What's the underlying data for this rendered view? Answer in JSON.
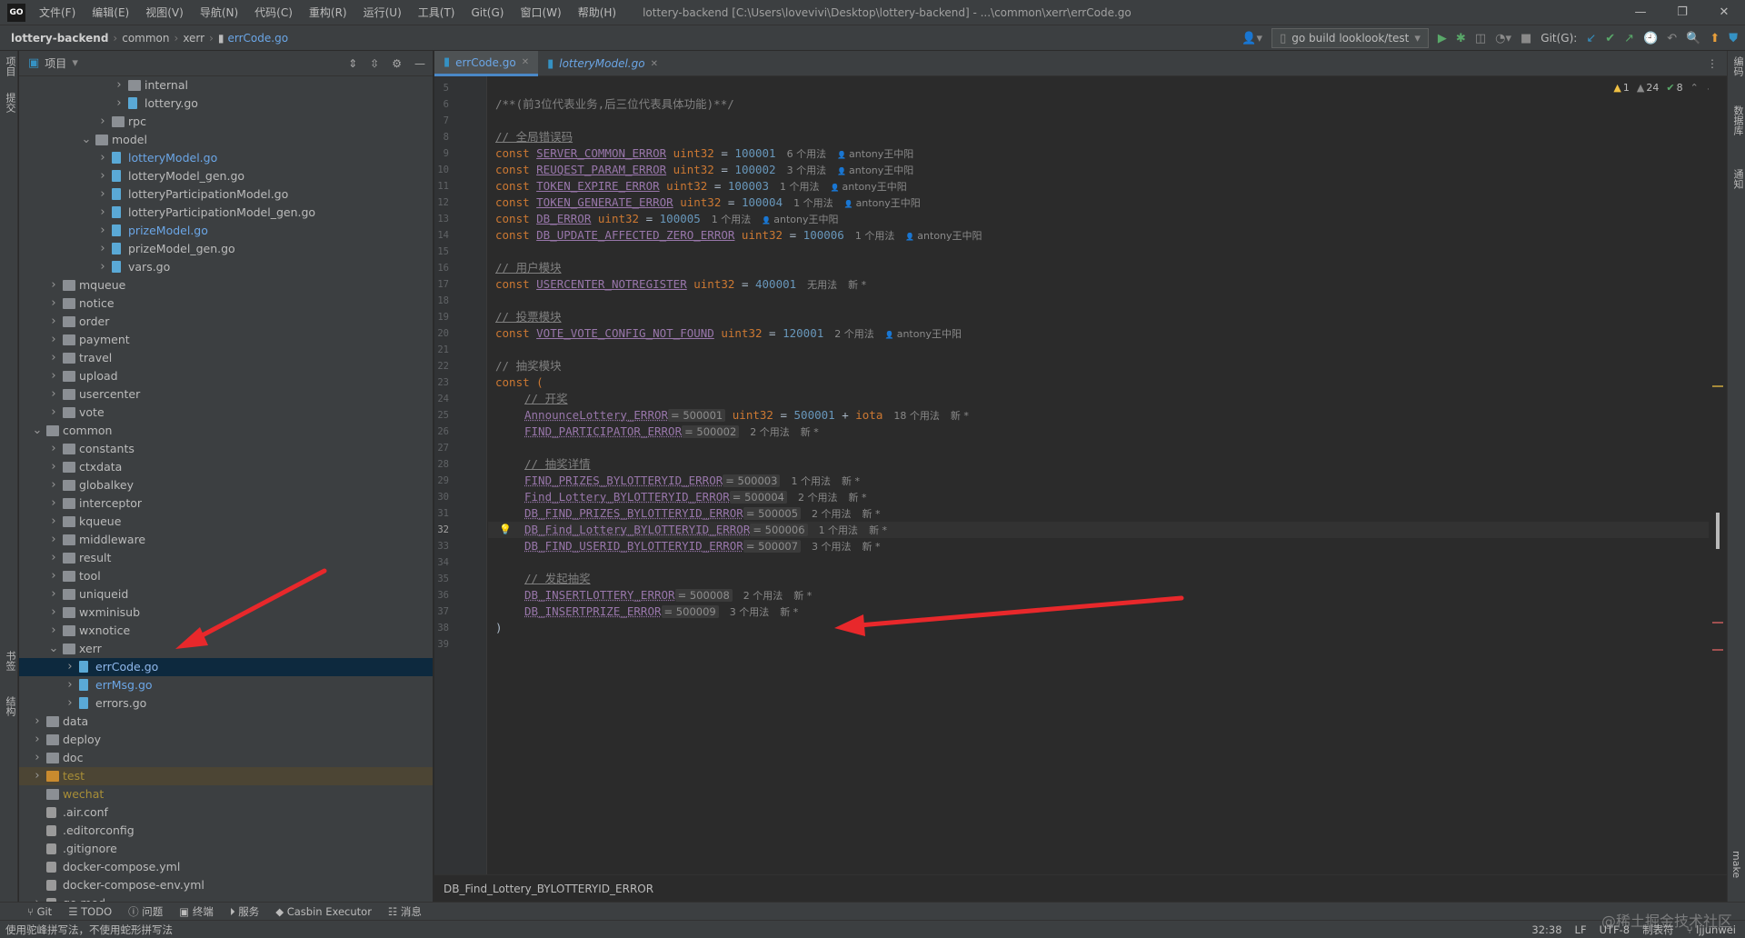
{
  "app": {
    "logo": "GO",
    "menu": [
      "文件(F)",
      "编辑(E)",
      "视图(V)",
      "导航(N)",
      "代码(C)",
      "重构(R)",
      "运行(U)",
      "工具(T)",
      "Git(G)",
      "窗口(W)",
      "帮助(H)"
    ],
    "window_title": "lottery-backend [C:\\Users\\lovevivi\\Desktop\\lottery-backend] - ...\\common\\xerr\\errCode.go",
    "win_controls": [
      "—",
      "❐",
      "✕"
    ]
  },
  "breadcrumb": [
    "lottery-backend",
    "common",
    "xerr",
    "errCode.go"
  ],
  "toolbar": {
    "run_config": "go build looklook/test",
    "git_label": "Git(G):"
  },
  "left_stripe": [
    "项目",
    "提交",
    "书签",
    "结构"
  ],
  "right_stripe": [
    "编码",
    "数据库",
    "通知",
    "make"
  ],
  "project_panel": {
    "title": "项目",
    "tree": [
      {
        "label": "internal",
        "type": "folder",
        "depth": 6,
        "arrow": "›"
      },
      {
        "label": "lottery.go",
        "type": "go",
        "depth": 6,
        "arrow": "›"
      },
      {
        "label": "rpc",
        "type": "folder",
        "depth": 5,
        "arrow": "›"
      },
      {
        "label": "model",
        "type": "folder",
        "depth": 4,
        "arrow": "⌄"
      },
      {
        "label": "lotteryModel.go",
        "type": "go",
        "depth": 5,
        "arrow": "›",
        "style": "blue"
      },
      {
        "label": "lotteryModel_gen.go",
        "type": "go",
        "depth": 5,
        "arrow": "›"
      },
      {
        "label": "lotteryParticipationModel.go",
        "type": "go",
        "depth": 5,
        "arrow": "›"
      },
      {
        "label": "lotteryParticipationModel_gen.go",
        "type": "go",
        "depth": 5,
        "arrow": "›"
      },
      {
        "label": "prizeModel.go",
        "type": "go",
        "depth": 5,
        "arrow": "›",
        "style": "blue"
      },
      {
        "label": "prizeModel_gen.go",
        "type": "go",
        "depth": 5,
        "arrow": "›"
      },
      {
        "label": "vars.go",
        "type": "go",
        "depth": 5,
        "arrow": "›"
      },
      {
        "label": "mqueue",
        "type": "folder",
        "depth": 2,
        "arrow": "›"
      },
      {
        "label": "notice",
        "type": "folder",
        "depth": 2,
        "arrow": "›"
      },
      {
        "label": "order",
        "type": "folder",
        "depth": 2,
        "arrow": "›"
      },
      {
        "label": "payment",
        "type": "folder",
        "depth": 2,
        "arrow": "›"
      },
      {
        "label": "travel",
        "type": "folder",
        "depth": 2,
        "arrow": "›"
      },
      {
        "label": "upload",
        "type": "folder",
        "depth": 2,
        "arrow": "›"
      },
      {
        "label": "usercenter",
        "type": "folder",
        "depth": 2,
        "arrow": "›"
      },
      {
        "label": "vote",
        "type": "folder",
        "depth": 2,
        "arrow": "›"
      },
      {
        "label": "common",
        "type": "folder",
        "depth": 1,
        "arrow": "⌄"
      },
      {
        "label": "constants",
        "type": "folder",
        "depth": 2,
        "arrow": "›"
      },
      {
        "label": "ctxdata",
        "type": "folder",
        "depth": 2,
        "arrow": "›"
      },
      {
        "label": "globalkey",
        "type": "folder",
        "depth": 2,
        "arrow": "›"
      },
      {
        "label": "interceptor",
        "type": "folder",
        "depth": 2,
        "arrow": "›"
      },
      {
        "label": "kqueue",
        "type": "folder",
        "depth": 2,
        "arrow": "›"
      },
      {
        "label": "middleware",
        "type": "folder",
        "depth": 2,
        "arrow": "›"
      },
      {
        "label": "result",
        "type": "folder",
        "depth": 2,
        "arrow": "›"
      },
      {
        "label": "tool",
        "type": "folder",
        "depth": 2,
        "arrow": "›"
      },
      {
        "label": "uniqueid",
        "type": "folder",
        "depth": 2,
        "arrow": "›"
      },
      {
        "label": "wxminisub",
        "type": "folder",
        "depth": 2,
        "arrow": "›"
      },
      {
        "label": "wxnotice",
        "type": "folder",
        "depth": 2,
        "arrow": "›"
      },
      {
        "label": "xerr",
        "type": "folder",
        "depth": 2,
        "arrow": "⌄"
      },
      {
        "label": "errCode.go",
        "type": "go",
        "depth": 3,
        "arrow": "›",
        "style": "bluehl",
        "selected": true
      },
      {
        "label": "errMsg.go",
        "type": "go",
        "depth": 3,
        "arrow": "›",
        "style": "blue"
      },
      {
        "label": "errors.go",
        "type": "go",
        "depth": 3,
        "arrow": "›"
      },
      {
        "label": "data",
        "type": "folder",
        "depth": 1,
        "arrow": "›"
      },
      {
        "label": "deploy",
        "type": "folder",
        "depth": 1,
        "arrow": "›"
      },
      {
        "label": "doc",
        "type": "folder",
        "depth": 1,
        "arrow": "›"
      },
      {
        "label": "test",
        "type": "folder-orange",
        "depth": 1,
        "arrow": "›",
        "style": "olive",
        "highlight": true
      },
      {
        "label": "wechat",
        "type": "folder",
        "depth": 1,
        "arrow": "",
        "style": "olive"
      },
      {
        "label": ".air.conf",
        "type": "conf",
        "depth": 1,
        "arrow": ""
      },
      {
        "label": ".editorconfig",
        "type": "conf",
        "depth": 1,
        "arrow": ""
      },
      {
        "label": ".gitignore",
        "type": "conf",
        "depth": 1,
        "arrow": ""
      },
      {
        "label": "docker-compose.yml",
        "type": "conf",
        "depth": 1,
        "arrow": ""
      },
      {
        "label": "docker-compose-env.yml",
        "type": "conf",
        "depth": 1,
        "arrow": ""
      },
      {
        "label": "go.mod",
        "type": "conf",
        "depth": 1,
        "arrow": "›"
      }
    ]
  },
  "tabs": [
    {
      "label": "errCode.go",
      "active": true,
      "italic": false
    },
    {
      "label": "lotteryModel.go",
      "active": false,
      "italic": true
    }
  ],
  "inspections": {
    "warnings": "1",
    "weak_warnings": "24",
    "ok": "8"
  },
  "editor": {
    "current_line": 32,
    "lines": [
      {
        "n": 5,
        "kind": "blank"
      },
      {
        "n": 6,
        "kind": "comment",
        "text": "/**(前3位代表业务,后三位代表具体功能)**/"
      },
      {
        "n": 7,
        "kind": "blank"
      },
      {
        "n": 8,
        "kind": "section",
        "text": "// 全局错误码"
      },
      {
        "n": 9,
        "kind": "const",
        "name": "SERVER_COMMON_ERROR",
        "value": "100001",
        "usages": "6 个用法",
        "author": "antony王中阳"
      },
      {
        "n": 10,
        "kind": "const",
        "name": "REUQEST_PARAM_ERROR",
        "value": "100002",
        "usages": "3 个用法",
        "author": "antony王中阳"
      },
      {
        "n": 11,
        "kind": "const",
        "name": "TOKEN_EXPIRE_ERROR",
        "value": "100003",
        "usages": "1 个用法",
        "author": "antony王中阳"
      },
      {
        "n": 12,
        "kind": "const",
        "name": "TOKEN_GENERATE_ERROR",
        "value": "100004",
        "usages": "1 个用法",
        "author": "antony王中阳"
      },
      {
        "n": 13,
        "kind": "const",
        "name": "DB_ERROR",
        "value": "100005",
        "usages": "1 个用法",
        "author": "antony王中阳"
      },
      {
        "n": 14,
        "kind": "const",
        "name": "DB_UPDATE_AFFECTED_ZERO_ERROR",
        "value": "100006",
        "usages": "1 个用法",
        "author": "antony王中阳"
      },
      {
        "n": 15,
        "kind": "blank"
      },
      {
        "n": 16,
        "kind": "section",
        "text": "// 用户模块"
      },
      {
        "n": 17,
        "kind": "const",
        "name": "USERCENTER_NOTREGISTER",
        "value": "400001",
        "usages": "无用法",
        "author": "新 *",
        "noicon": true
      },
      {
        "n": 18,
        "kind": "blank"
      },
      {
        "n": 19,
        "kind": "section",
        "text": "// 投票模块"
      },
      {
        "n": 20,
        "kind": "const",
        "name": "VOTE_VOTE_CONFIG_NOT_FOUND",
        "value": "120001",
        "usages": "2 个用法",
        "author": "antony王中阳"
      },
      {
        "n": 21,
        "kind": "blank"
      },
      {
        "n": 22,
        "kind": "plaincomment",
        "text": "// 抽奖模块"
      },
      {
        "n": 23,
        "kind": "open",
        "text": "const ("
      },
      {
        "n": 24,
        "kind": "subsection",
        "text": "// 开奖"
      },
      {
        "n": 25,
        "kind": "iota",
        "name": "AnnounceLottery_ERROR",
        "inlay": "= 500001",
        "value": "500001",
        "usages": "18 个用法",
        "author": "新 *"
      },
      {
        "n": 26,
        "kind": "item",
        "name": "FIND_PARTICIPATOR_ERROR",
        "inlay": "= 500002",
        "usages": "2 个用法",
        "author": "新 *"
      },
      {
        "n": 27,
        "kind": "blank"
      },
      {
        "n": 28,
        "kind": "subsection",
        "text": "// 抽奖详情"
      },
      {
        "n": 29,
        "kind": "item",
        "name": "FIND_PRIZES_BYLOTTERYID_ERROR",
        "inlay": "= 500003",
        "usages": "1 个用法",
        "author": "新 *"
      },
      {
        "n": 30,
        "kind": "item",
        "name": "Find_Lottery_BYLOTTERYID_ERROR",
        "inlay": "= 500004",
        "usages": "2 个用法",
        "author": "新 *"
      },
      {
        "n": 31,
        "kind": "item",
        "name": "DB_FIND_PRIZES_BYLOTTERYID_ERROR",
        "inlay": "= 500005",
        "usages": "2 个用法",
        "author": "新 *"
      },
      {
        "n": 32,
        "kind": "item",
        "name": "DB_Find_Lottery_BYLOTTERYID_ERROR",
        "inlay": "= 500006",
        "usages": "1 个用法",
        "author": "新 *",
        "bulb": true
      },
      {
        "n": 33,
        "kind": "item",
        "name": "DB_FIND_USERID_BYLOTTERYID_ERROR",
        "inlay": "= 500007",
        "usages": "3 个用法",
        "author": "新 *"
      },
      {
        "n": 34,
        "kind": "blank"
      },
      {
        "n": 35,
        "kind": "subsection",
        "text": "// 发起抽奖"
      },
      {
        "n": 36,
        "kind": "item",
        "name": "DB_INSERTLOTTERY_ERROR",
        "inlay": "= 500008",
        "usages": "2 个用法",
        "author": "新 *"
      },
      {
        "n": 37,
        "kind": "item",
        "name": "DB_INSERTPRIZE_ERROR",
        "inlay": "= 500009",
        "usages": "3 个用法",
        "author": "新 *"
      },
      {
        "n": 38,
        "kind": "close",
        "text": ")"
      },
      {
        "n": 39,
        "kind": "blank"
      }
    ]
  },
  "code_keywords": {
    "const": "const",
    "type": "uint32",
    "iota": "iota",
    "plus": "+"
  },
  "editor_breadcrumb": "DB_Find_Lottery_BYLOTTERYID_ERROR",
  "bottom_tools": [
    "Git",
    "TODO",
    "问题",
    "终端",
    "服务",
    "Casbin Executor",
    "消息"
  ],
  "status": {
    "message": "使用驼峰拼写法，不使用蛇形拼写法",
    "position": "32:38",
    "line_sep": "LF",
    "encoding": "UTF-8",
    "indent": "制表符",
    "branch": "ljjunwei"
  },
  "watermark": "@稀土掘金技术社区"
}
